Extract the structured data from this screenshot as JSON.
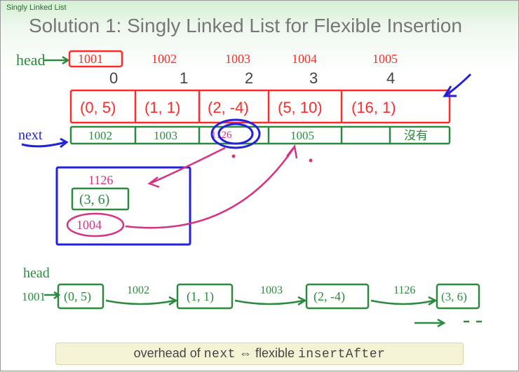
{
  "topbar": {
    "label": "Singly Linked List"
  },
  "title": "Solution 1: Singly Linked List for Flexible Insertion",
  "labels": {
    "head": "head",
    "next": "next",
    "none": "沒有",
    "head2": "head"
  },
  "addresses": [
    "1001",
    "1002",
    "1003",
    "1004",
    "1005"
  ],
  "indices": [
    "0",
    "1",
    "2",
    "3",
    "4"
  ],
  "cells": [
    "(0, 5)",
    "(1, 1)",
    "(2, -4)",
    "(5, 10)",
    "(16, 1)"
  ],
  "nextptrs": [
    "1002",
    "1003",
    "",
    "1005"
  ],
  "new_node": {
    "addr": "1126",
    "value": "(3, 6)",
    "next": "1004"
  },
  "scribble_addr": "1126",
  "bottom": {
    "addr0": "1001",
    "node0": "(0, 5)",
    "link1": "1002",
    "node1": "(1, 1)",
    "link2": "1003",
    "node2": "(2, -4)",
    "link3": "1126",
    "node3": "(3, 6)"
  },
  "footer": {
    "t1": "overhead of ",
    "c1": "next",
    "arrow": " ⇔ ",
    "t2": "flexible ",
    "c2": "insertAfter"
  }
}
